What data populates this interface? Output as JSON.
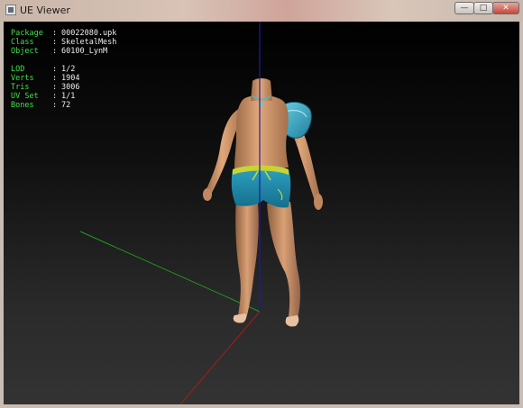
{
  "window": {
    "title": "UE Viewer",
    "min_symbol": "—",
    "max_symbol": "□",
    "close_symbol": "✕"
  },
  "info": {
    "package": {
      "label": "Package",
      "sep": ":",
      "value": "00022080.upk"
    },
    "class": {
      "label": "Class",
      "sep": ":",
      "value": "SkeletalMesh"
    },
    "object": {
      "label": "Object",
      "sep": ":",
      "value": "60100_LynM"
    },
    "lod": {
      "label": "LOD",
      "sep": ":",
      "value": "1/2"
    },
    "verts": {
      "label": "Verts",
      "sep": ":",
      "value": "1904"
    },
    "tris": {
      "label": "Tris",
      "sep": ":",
      "value": "3006"
    },
    "uvset": {
      "label": "UV Set",
      "sep": ":",
      "value": "1/1"
    },
    "bones": {
      "label": "Bones",
      "sep": ":",
      "value": "72"
    }
  },
  "colors": {
    "label_green": "#3fe04a",
    "axis_x": "#b81e1e",
    "axis_y": "#1a9a1a",
    "axis_z": "#1a1aa8",
    "skin": "#d49a6e",
    "shorts": "#1f8fb0",
    "waistband": "#c8d431",
    "armband": "#3aa6c4"
  }
}
